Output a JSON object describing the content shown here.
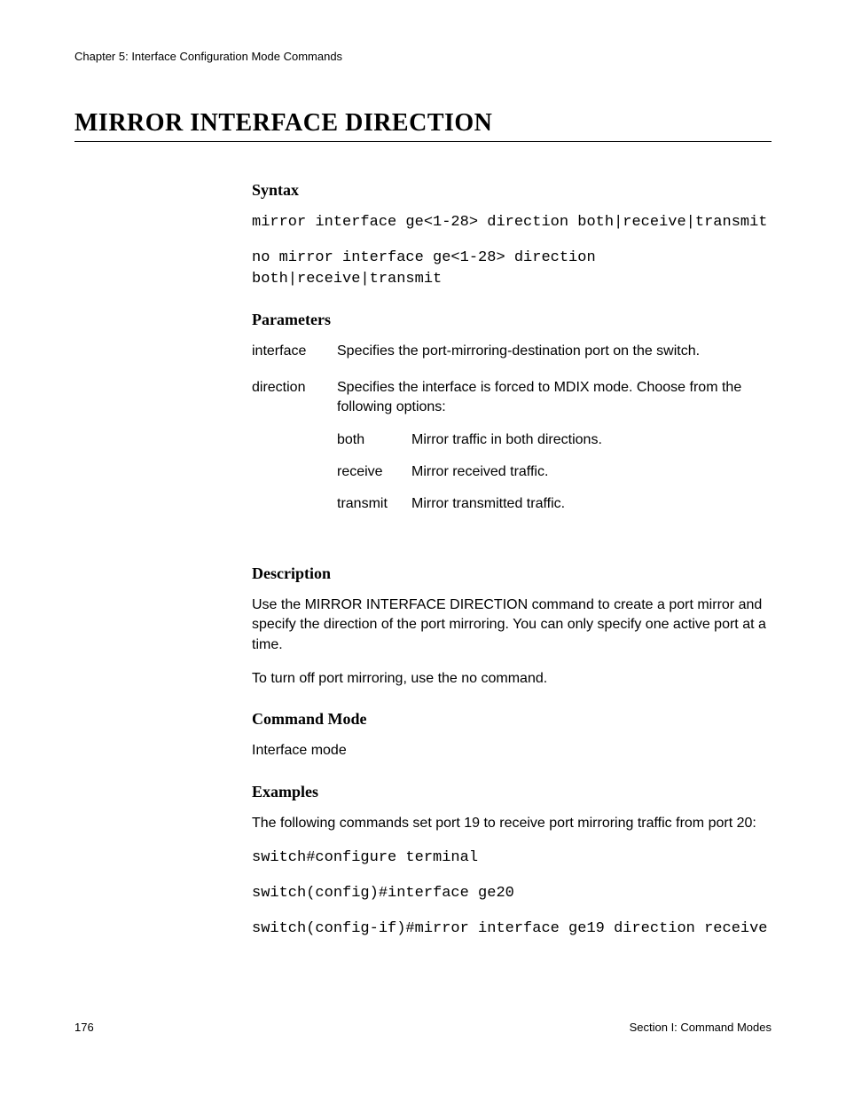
{
  "chapter_header": "Chapter 5: Interface Configuration Mode Commands",
  "title": "MIRROR INTERFACE DIRECTION",
  "sections": {
    "syntax": {
      "heading": "Syntax",
      "lines": [
        "mirror interface ge<1-28> direction both|receive|transmit",
        "no mirror interface ge<1-28> direction both|receive|transmit"
      ]
    },
    "parameters": {
      "heading": "Parameters",
      "rows": [
        {
          "name": "interface",
          "desc": "Specifies the port-mirroring-destination port on the switch."
        },
        {
          "name": "direction",
          "desc": "Specifies the interface is forced to MDIX mode. Choose from the following options:",
          "options": [
            {
              "name": "both",
              "desc": "Mirror traffic in both directions."
            },
            {
              "name": "receive",
              "desc": "Mirror received traffic."
            },
            {
              "name": "transmit",
              "desc": "Mirror transmitted traffic."
            }
          ]
        }
      ]
    },
    "description": {
      "heading": "Description",
      "paras": [
        "Use the MIRROR INTERFACE DIRECTION command to create a port mirror and specify the direction of the port mirroring. You can only specify one active port at a time.",
        "To turn off port mirroring, use the no command."
      ]
    },
    "command_mode": {
      "heading": "Command Mode",
      "text": "Interface mode"
    },
    "examples": {
      "heading": "Examples",
      "intro": "The following commands set port 19 to receive port mirroring traffic from port 20:",
      "cmds": [
        "switch#configure terminal",
        "switch(config)#interface ge20",
        "switch(config-if)#mirror interface ge19 direction receive"
      ]
    }
  },
  "footer": {
    "page_number": "176",
    "section_label": "Section I: Command Modes"
  }
}
